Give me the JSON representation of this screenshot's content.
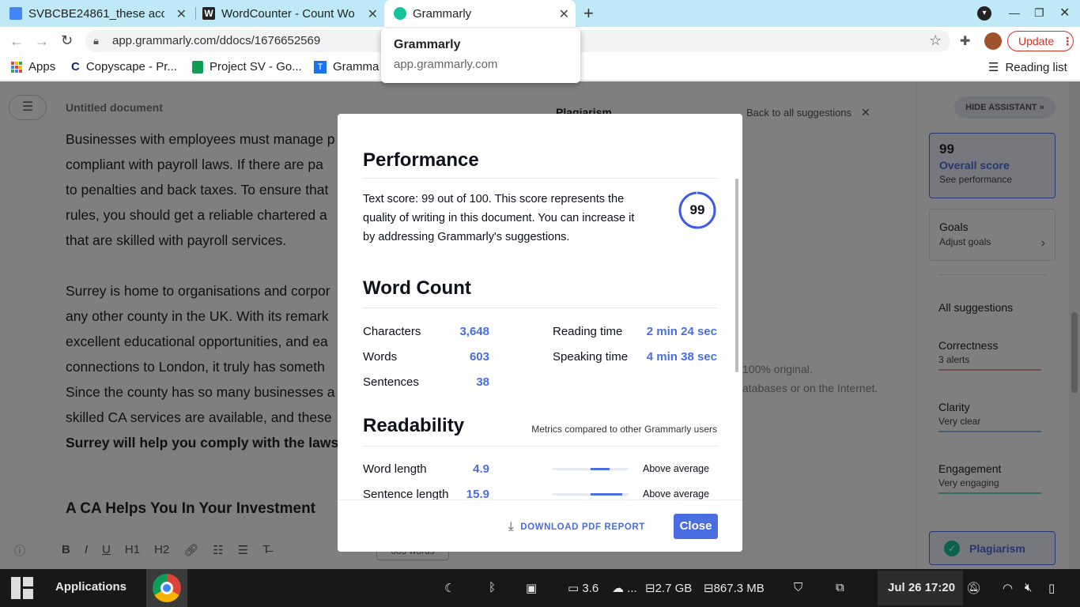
{
  "tabs": [
    {
      "title": "SVBCBE24861_these acc",
      "favicon_color": "#4285f4"
    },
    {
      "title": "WordCounter - Count Wo",
      "favicon_color": "#222222"
    },
    {
      "title": "Grammarly",
      "favicon_color": "#15c39a"
    }
  ],
  "tooltip": {
    "title": "Grammarly",
    "domain": "app.grammarly.com"
  },
  "address": {
    "url": "app.grammarly.com/ddocs/1676652569",
    "update_label": "Update"
  },
  "bookmarks": {
    "apps": "Apps",
    "items": [
      "Copyscape - Pr...",
      "Project SV - Go...",
      "Gramma"
    ],
    "reading_list": "Reading list"
  },
  "doc": {
    "title": "Untitled document",
    "lines": [
      "Businesses with employees must manage p",
      "compliant with payroll laws. If there are pa",
      "to penalties and back taxes. To ensure that",
      "rules, you should get a reliable chartered a",
      "that are skilled with payroll services.",
      "Surrey is home to organisations and corpor",
      "any other county in the UK. With its remark",
      "excellent educational opportunities, and ea",
      "connections to London, it truly has someth",
      "Since the county has so many businesses a",
      "skilled CA services are available, and these",
      "Surrey will help you comply with the laws."
    ],
    "heading": "A CA Helps You In Your Investment",
    "word_count_chip": "603 words"
  },
  "plagiarism_panel": {
    "title": "Plagiarism",
    "back": "Back to all suggestions",
    "original_text": "100% original.",
    "sub_text": "atabases or on the Internet."
  },
  "modal": {
    "performance": {
      "heading": "Performance",
      "text": "Text score: 99 out of 100. This score represents the quality of writing in this document. You can increase it by addressing Grammarly's suggestions.",
      "score": "99",
      "score_fraction": 0.99
    },
    "word_count": {
      "heading": "Word Count",
      "left": [
        {
          "label": "Characters",
          "value": "3,648"
        },
        {
          "label": "Words",
          "value": "603"
        },
        {
          "label": "Sentences",
          "value": "38"
        }
      ],
      "right": [
        {
          "label": "Reading time",
          "value": "2 min 24 sec"
        },
        {
          "label": "Speaking time",
          "value": "4 min 38 sec"
        }
      ]
    },
    "readability": {
      "heading": "Readability",
      "note": "Metrics compared to other Grammarly users",
      "rows": [
        {
          "label": "Word length",
          "value": "4.9",
          "rating": "Above average"
        },
        {
          "label": "Sentence length",
          "value": "15.9",
          "rating": "Above average"
        }
      ]
    },
    "download_label": "DOWNLOAD PDF REPORT",
    "close_label": "Close"
  },
  "assistant": {
    "hide_label": "HIDE ASSISTANT",
    "score": "99",
    "score_label": "Overall score",
    "see_performance": "See performance",
    "goals": "Goals",
    "adjust_goals": "Adjust goals",
    "all_suggestions": "All suggestions",
    "categories": [
      {
        "name": "Correctness",
        "sub": "3 alerts",
        "color": "#e05d6f"
      },
      {
        "name": "Clarity",
        "sub": "Very clear",
        "color": "#4a8de0"
      },
      {
        "name": "Engagement",
        "sub": "Very engaging",
        "color": "#15c39a"
      }
    ],
    "plagiarism": "Plagiarism"
  },
  "taskbar": {
    "applications": "Applications",
    "cpu": "3.6",
    "cloud": "...",
    "disk": "2.7 GB",
    "memory": "867.3 MB",
    "datetime": "Jul 26  17:20"
  }
}
